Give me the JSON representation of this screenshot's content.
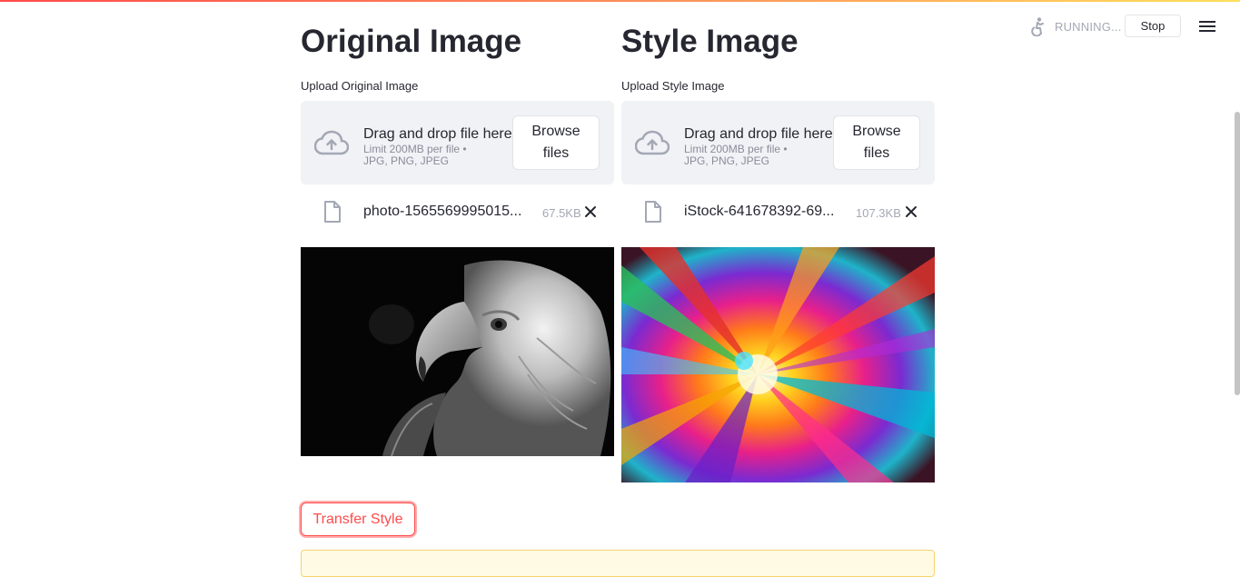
{
  "status": {
    "running_text": "RUNNING...",
    "stop_label": "Stop",
    "icon": "running-figure-icon"
  },
  "menu": {
    "icon": "hamburger-menu-icon"
  },
  "columns": [
    {
      "heading": "Original Image",
      "upload_label": "Upload Original Image",
      "dropzone": {
        "title": "Drag and drop file here",
        "limit": "Limit 200MB per file • JPG, PNG, JPEG",
        "browse_label": "Browse files"
      },
      "file": {
        "name": "photo-1565569995015...",
        "size": "67.5KB"
      },
      "preview": "eagle-image"
    },
    {
      "heading": "Style Image",
      "upload_label": "Upload Style Image",
      "dropzone": {
        "title": "Drag and drop file here",
        "limit": "Limit 200MB per file • JPG, PNG, JPEG",
        "browse_label": "Browse files"
      },
      "file": {
        "name": "iStock-641678392-69...",
        "size": "107.3KB"
      },
      "preview": "color-burst-image"
    }
  ],
  "actions": {
    "transfer_label": "Transfer Style"
  },
  "colors": {
    "accent": "#ff4b4b",
    "text": "#262730",
    "muted": "#a3a8b4",
    "dropzone_bg": "#f0f2f6",
    "alert_bg": "#fffae3"
  }
}
